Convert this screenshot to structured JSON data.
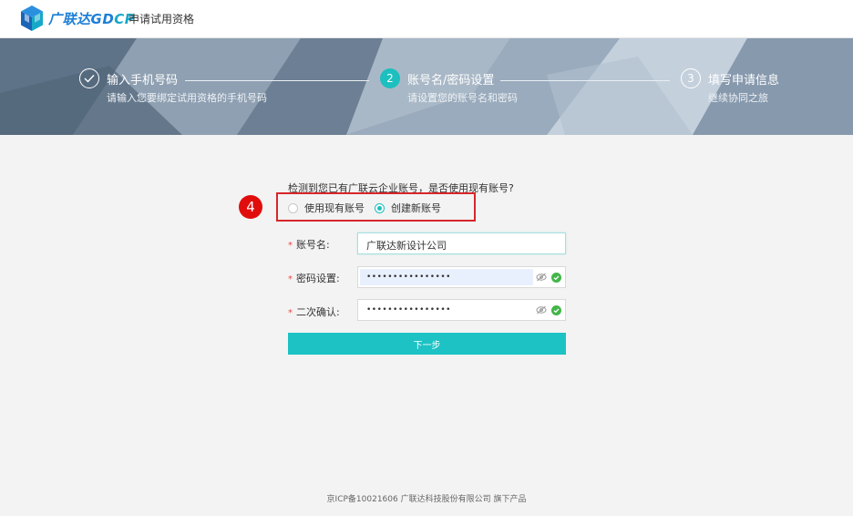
{
  "header": {
    "logo_text": "广联达",
    "logo_gd": "GD",
    "logo_cp": "CP",
    "subtitle": "申请试用资格"
  },
  "steps": [
    {
      "index": "1",
      "title": "输入手机号码",
      "desc": "请输入您要绑定试用资格的手机号码",
      "state": "done"
    },
    {
      "index": "2",
      "title": "账号名/密码设置",
      "desc": "请设置您的账号名和密码",
      "state": "active"
    },
    {
      "index": "3",
      "title": "填写申请信息",
      "desc": "继续协同之旅",
      "state": "todo"
    }
  ],
  "form": {
    "question": "检测到您已有广联云企业账号，是否使用现有账号?",
    "annotation_badge": "4",
    "options": [
      {
        "label": "使用现有账号",
        "checked": false
      },
      {
        "label": "创建新账号",
        "checked": true
      }
    ],
    "account": {
      "label": "账号名:",
      "value": "广联达新设计公司"
    },
    "password": {
      "label": "密码设置:",
      "value": "••••••••••••••••"
    },
    "confirm": {
      "label": "二次确认:",
      "value": "••••••••••••••••"
    },
    "required_mark": "*",
    "next_label": "下一步"
  },
  "footer": {
    "text": "京ICP备10021606 广联达科技股份有限公司 旗下产品"
  },
  "colors": {
    "accent": "#1dc2c4",
    "brand": "#1d7fd6",
    "highlight": "#d7262b",
    "badge": "#e10d0d",
    "ok": "#43b549"
  },
  "icons": [
    "logo-cube-icon",
    "check-icon",
    "eye-off-icon",
    "check-circle-icon"
  ]
}
